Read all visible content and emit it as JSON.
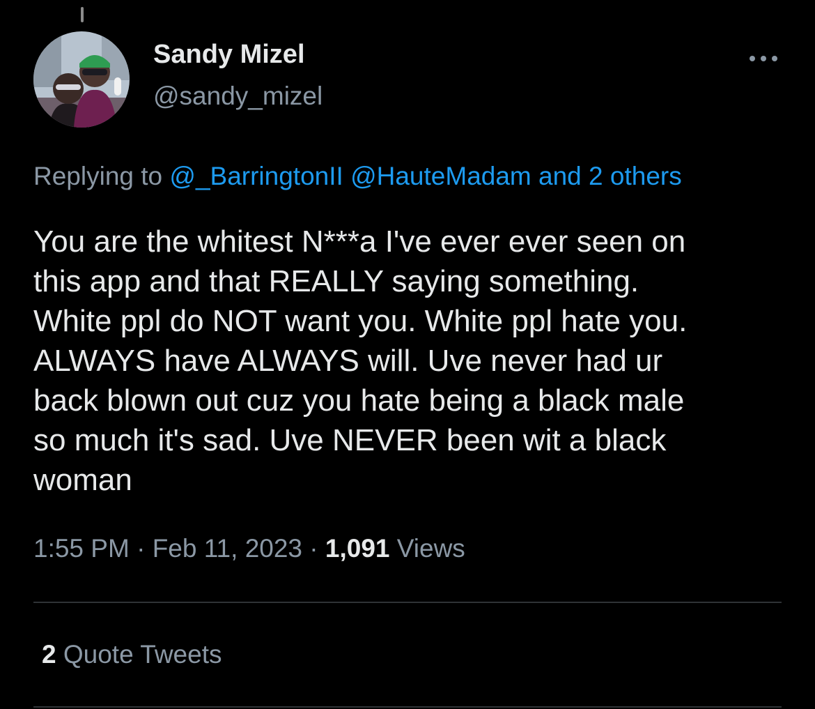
{
  "tweet": {
    "author": {
      "name": "Sandy Mizel",
      "handle": "@sandy_mizel"
    },
    "replying_to": {
      "prefix": "Replying to",
      "mentions": "@_BarringtonII @HauteMadam and 2 others"
    },
    "text": "You are the whitest N***a I've ever ever seen on\nthis app and that REALLY saying something.\nWhite ppl do NOT want you. White ppl hate you.\nALWAYS have ALWAYS will. Uve never had ur\nback blown out cuz you hate being a black male\nso much it's sad. Uve NEVER been wit a black\nwoman",
    "time": "1:55 PM",
    "sep1": " · ",
    "date": "Feb 11, 2023",
    "sep2": " · ",
    "views_count": "1,091",
    "views_label": " Views",
    "quote_count": "2",
    "quote_label": " Quote Tweets"
  },
  "icons": {
    "more": "more-options-icon",
    "avatar": "avatar-photo"
  },
  "colors": {
    "background": "#000000",
    "primary_text": "#e7e9ea",
    "secondary_text": "#8b98a5",
    "link": "#1d9bf0",
    "divider": "#2f3336"
  }
}
